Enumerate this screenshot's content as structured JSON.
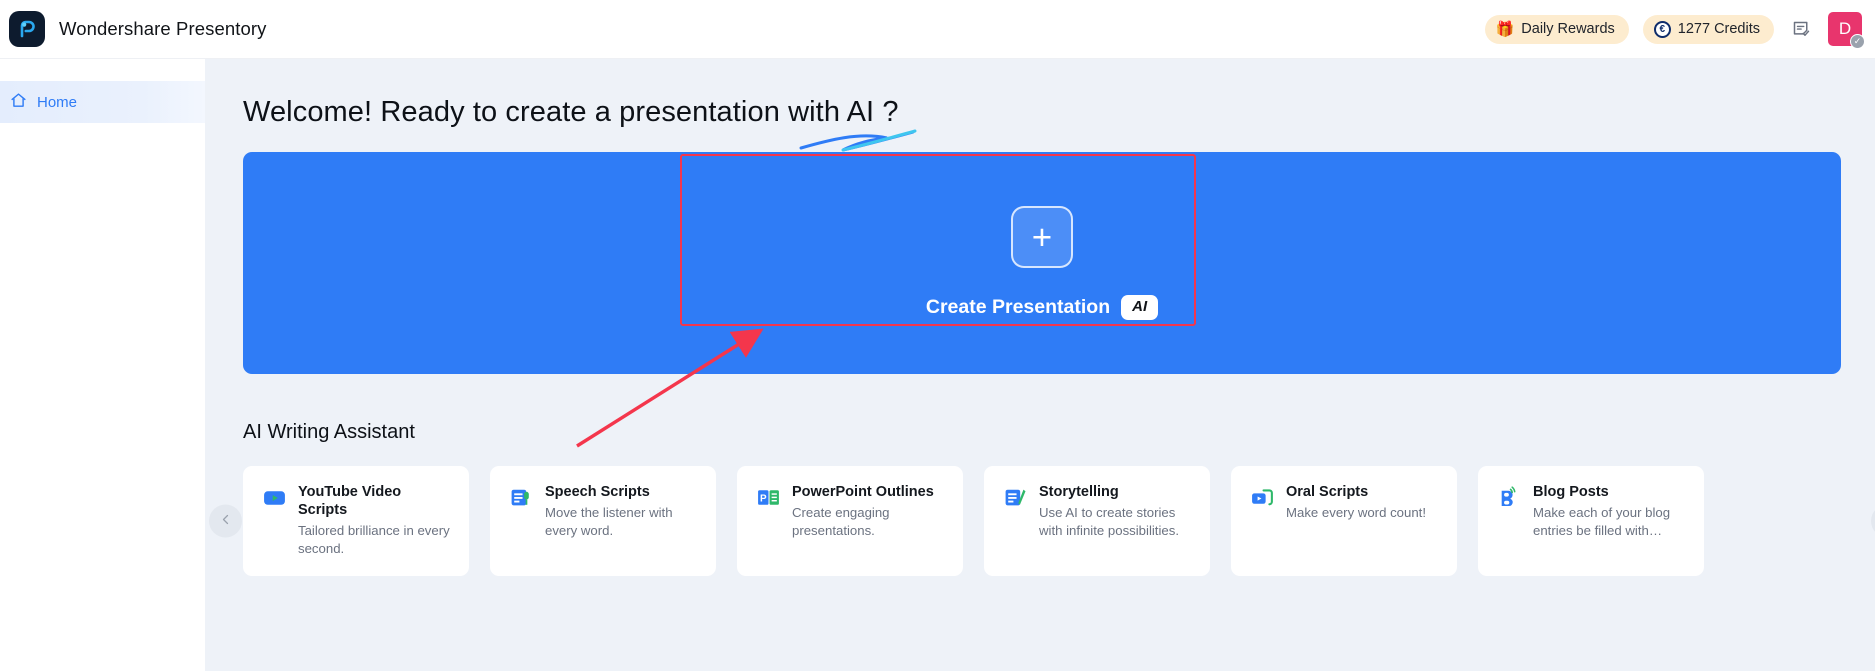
{
  "topbar": {
    "brand_name": "Wondershare Presentory",
    "logo_icon": "presentory-logo-icon",
    "daily_rewards": {
      "label": "Daily Rewards",
      "icon": "gift-icon"
    },
    "credits": {
      "label": "1277 Credits",
      "icon": "coin-icon",
      "value": "1277"
    },
    "feedback_icon": "feedback-checklist-icon",
    "avatar": {
      "initial": "D",
      "vip_badge": "✓",
      "color": "#e8356d"
    }
  },
  "sidebar": {
    "items": [
      {
        "label": "Home",
        "icon": "home-icon",
        "active": true
      }
    ]
  },
  "main": {
    "welcome_title": "Welcome! Ready to create a presentation with AI ?",
    "banner": {
      "plus_icon": "plus-icon",
      "create_label": "Create Presentation",
      "ai_badge": "AI",
      "background_color": "#2f7cf6",
      "highlight_color": "#f4364c"
    },
    "section_title": "AI Writing Assistant",
    "carousel": {
      "prev_icon": "chevron-left-icon",
      "next_icon": "chevron-right-icon",
      "cards": [
        {
          "title": "YouTube Video Scripts",
          "desc": "Tailored brilliance in every second.",
          "icon": "youtube-play-icon"
        },
        {
          "title": "Speech Scripts",
          "desc": "Move the listener with every word.",
          "icon": "document-microphone-icon"
        },
        {
          "title": "PowerPoint Outlines",
          "desc": "Create engaging presentations.",
          "icon": "powerpoint-icon"
        },
        {
          "title": "Storytelling",
          "desc": "Use AI to create stories with infinite possibilities.",
          "icon": "document-pencil-icon"
        },
        {
          "title": "Oral Scripts",
          "desc": "Make every word count!",
          "icon": "play-arrow-icon"
        },
        {
          "title": "Blog Posts",
          "desc": "Make each of your blog entries be filled with…",
          "icon": "blog-signal-icon"
        }
      ]
    }
  }
}
